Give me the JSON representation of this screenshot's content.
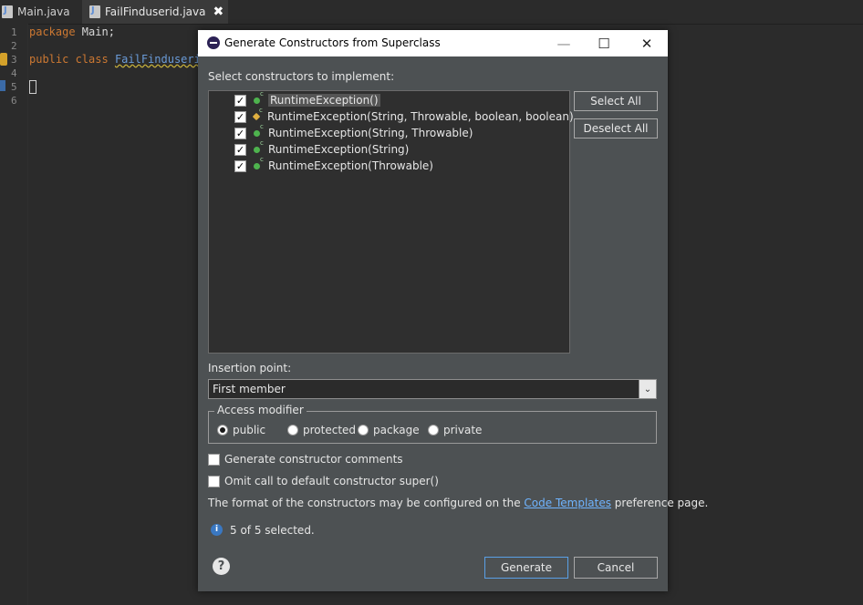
{
  "editor": {
    "tabs": [
      {
        "label": "Main.java"
      },
      {
        "label": "FailFinduserid.java"
      }
    ],
    "lines": [
      {
        "num": "1",
        "kw": "package",
        "rest": " Main;"
      },
      {
        "num": "2"
      },
      {
        "num": "3",
        "kw": "public class",
        "cls": "FailFinduseri"
      },
      {
        "num": "4"
      },
      {
        "num": "5"
      },
      {
        "num": "6"
      }
    ],
    "close_glyph": "✖"
  },
  "dialog": {
    "title": "Generate Constructors from Superclass",
    "window_controls": {
      "minimize": "—",
      "maximize": "☐",
      "close": "✕"
    },
    "select_label": "Select constructors to implement:",
    "constructors": [
      {
        "label": "RuntimeException()",
        "checked": true,
        "icon": "public-constructor-icon"
      },
      {
        "label": "RuntimeException(String, Throwable, boolean, boolean)",
        "checked": true,
        "icon": "protected-constructor-icon"
      },
      {
        "label": "RuntimeException(String, Throwable)",
        "checked": true,
        "icon": "public-constructor-icon"
      },
      {
        "label": "RuntimeException(String)",
        "checked": true,
        "icon": "public-constructor-icon"
      },
      {
        "label": "RuntimeException(Throwable)",
        "checked": true,
        "icon": "public-constructor-icon"
      }
    ],
    "check_glyph": "✓",
    "select_all": "Select All",
    "deselect_all": "Deselect All",
    "insertion_label": "Insertion point:",
    "insertion_value": "First member",
    "combo_arrow": "⌄",
    "access_modifier": {
      "legend": "Access modifier",
      "options": [
        "public",
        "protected",
        "package",
        "private"
      ],
      "selected": "public"
    },
    "gen_comments": "Generate constructor comments",
    "omit_super": "Omit call to default constructor super()",
    "format_text_pre": "The format of the constructors may be configured on the ",
    "format_link": "Code Templates",
    "format_text_post": " preference page.",
    "status": "5 of 5 selected.",
    "info_glyph": "i",
    "help_glyph": "?",
    "generate": "Generate",
    "cancel": "Cancel"
  }
}
